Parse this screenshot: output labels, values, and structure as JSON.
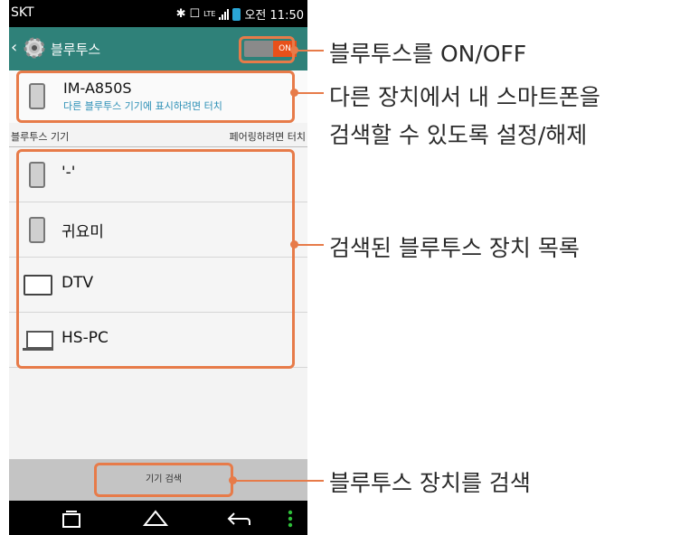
{
  "status_bar": {
    "carrier": "SKT",
    "network": "LTE",
    "time": "오전 11:50"
  },
  "action_bar": {
    "title": "블루투스",
    "toggle_state": "ON"
  },
  "own_device": {
    "name": "IM-A850S",
    "subtitle": "다른 블루투스 기기에 표시하려면 터치"
  },
  "section": {
    "left_label": "블루투스 기기",
    "right_label": "페어링하려면 터치"
  },
  "devices": [
    {
      "name": "'-'",
      "icon": "phone-icon"
    },
    {
      "name": "귀요미",
      "icon": "phone-icon"
    },
    {
      "name": "DTV",
      "icon": "tv-icon"
    },
    {
      "name": "HS-PC",
      "icon": "laptop-icon"
    }
  ],
  "bottom_bar": {
    "scan_label": "기기 검색"
  },
  "annotations": {
    "toggle": "블루투스를 ON/OFF",
    "visibility_line1": "다른 장치에서 내 스마트폰을",
    "visibility_line2": "검색할 수 있도록 설정/해제",
    "device_list": "검색된 블루투스 장치 목록",
    "scan": "블루투스 장치를 검색"
  },
  "colors": {
    "action_bar": "#2f8179",
    "toggle_on": "#e8501a",
    "callout": "#e77b49",
    "subtitle": "#2b8fb5"
  }
}
